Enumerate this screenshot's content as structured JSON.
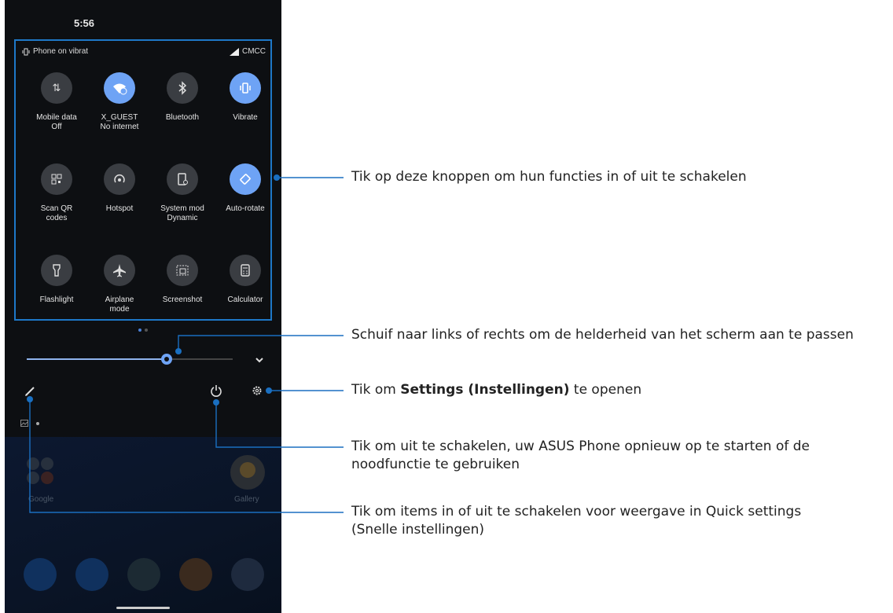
{
  "status": {
    "time": "5:56",
    "vibrate_text": "Phone on vibrat",
    "carrier": "CMCC"
  },
  "tiles": [
    {
      "label": "Mobile data\nOff",
      "icon": "mobile-data-icon",
      "on": false
    },
    {
      "label": "X_GUEST\nNo internet",
      "icon": "wifi-icon",
      "on": true
    },
    {
      "label": "Bluetooth",
      "icon": "bluetooth-icon",
      "on": false
    },
    {
      "label": "Vibrate",
      "icon": "vibrate-icon",
      "on": true
    },
    {
      "label": "Scan QR\ncodes",
      "icon": "qr-code-icon",
      "on": false
    },
    {
      "label": "Hotspot",
      "icon": "hotspot-icon",
      "on": false
    },
    {
      "label": "System mod\nDynamic",
      "icon": "system-mode-icon",
      "on": false
    },
    {
      "label": "Auto-rotate",
      "icon": "auto-rotate-icon",
      "on": true
    },
    {
      "label": "Flashlight",
      "icon": "flashlight-icon",
      "on": false
    },
    {
      "label": "Airplane\nmode",
      "icon": "airplane-icon",
      "on": false
    },
    {
      "label": "Screenshot",
      "icon": "screenshot-icon",
      "on": false
    },
    {
      "label": "Calculator",
      "icon": "calculator-icon",
      "on": false
    }
  ],
  "brightness": {
    "level": 0.68
  },
  "home": {
    "folder_label": "Google",
    "gallery_label": "Gallery"
  },
  "captions": {
    "tiles": "Tik op deze knoppen om hun functies in of uit te schakelen",
    "brightness": "Schuif naar links of rechts om de helderheid van het scherm aan te passen",
    "settings_pre": "Tik om ",
    "settings_bold": "Settings (Instellingen)",
    "settings_post": " te openen",
    "power_line1": "Tik om uit te schakelen, uw ASUS Phone opnieuw op te starten of de",
    "power_line2": "noodfunctie te gebruiken",
    "edit_line1": "Tik om items in of uit te schakelen voor weergave in Quick settings",
    "edit_line2": "(Snelle instellingen)"
  },
  "colors": {
    "accent": "#1e78c8",
    "tile_on": "#6ea3f5",
    "tile_off": "#3a3d42"
  }
}
